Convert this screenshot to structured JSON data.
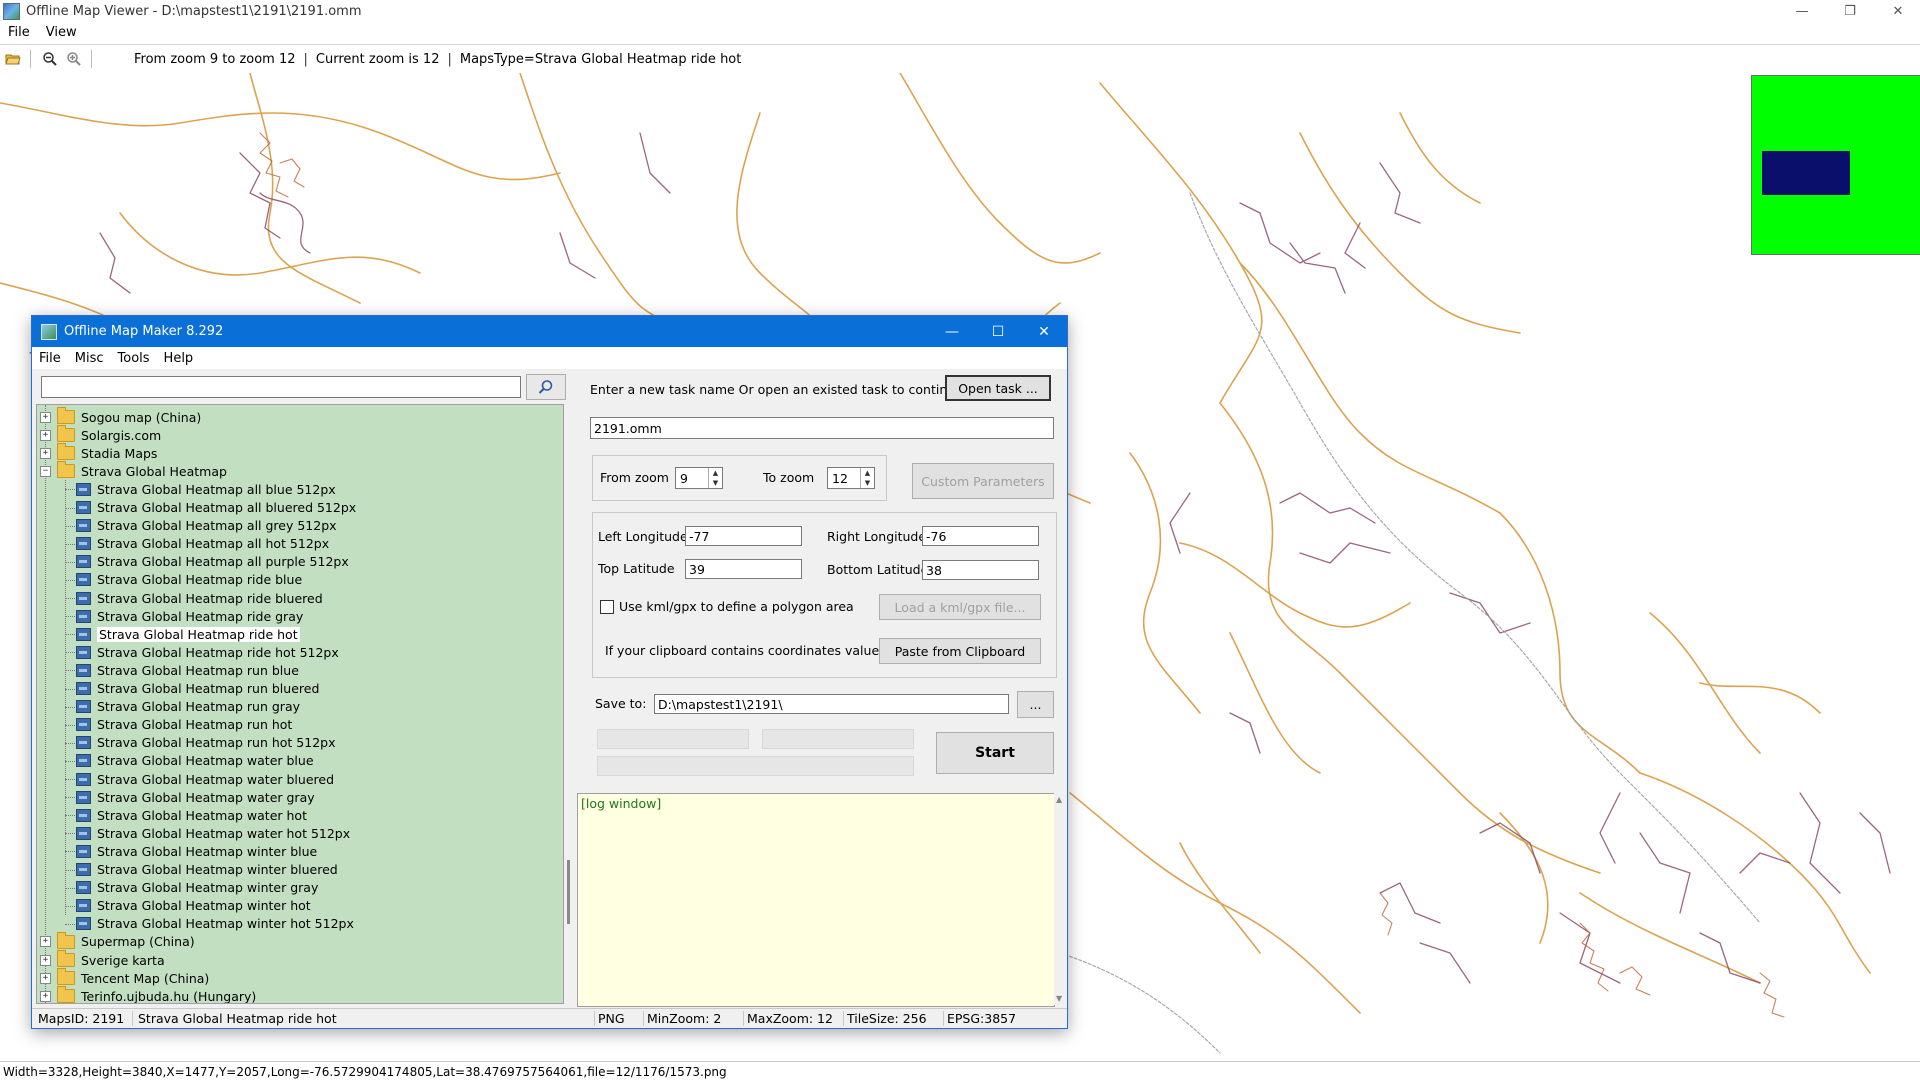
{
  "viewer": {
    "title": "Offline Map Viewer - D:\\mapstest1\\2191\\2191.omm",
    "menu": [
      "File",
      "View"
    ],
    "toolbar": {
      "zoom_range": "From zoom 9 to zoom 12",
      "current_zoom": "Current zoom is 12",
      "maps_type": "MapsType=Strava Global Heatmap ride hot",
      "pipe": "|"
    },
    "status": "Width=3328,Height=3840,X=1477,Y=2057,Long=-76.5729904174805,Lat=38.4769757564061,file=12/1176/1573.png",
    "minimap_color": "#00ff00",
    "minimap_view_color": "#0a0f6b"
  },
  "dialog": {
    "title": "Offline Map Maker 8.292",
    "menu": [
      "File",
      "Misc",
      "Tools",
      "Help"
    ],
    "tree": {
      "items": [
        {
          "label": "Sogou map (China)",
          "type": "folder",
          "expanded": false
        },
        {
          "label": "Solargis.com",
          "type": "folder",
          "expanded": false
        },
        {
          "label": "Stadia Maps",
          "type": "folder",
          "expanded": false
        },
        {
          "label": "Strava Global Heatmap",
          "type": "folder",
          "expanded": true
        },
        {
          "label": "Strava Global Heatmap all blue 512px",
          "type": "map"
        },
        {
          "label": "Strava Global Heatmap all bluered 512px",
          "type": "map"
        },
        {
          "label": "Strava Global Heatmap all grey 512px",
          "type": "map"
        },
        {
          "label": "Strava Global Heatmap all hot 512px",
          "type": "map"
        },
        {
          "label": "Strava Global Heatmap all purple 512px",
          "type": "map"
        },
        {
          "label": "Strava Global Heatmap ride blue",
          "type": "map"
        },
        {
          "label": "Strava Global Heatmap ride bluered",
          "type": "map"
        },
        {
          "label": "Strava Global Heatmap ride gray",
          "type": "map"
        },
        {
          "label": "Strava Global Heatmap ride hot",
          "type": "map",
          "selected": true
        },
        {
          "label": "Strava Global Heatmap ride hot 512px",
          "type": "map"
        },
        {
          "label": "Strava Global Heatmap run blue",
          "type": "map"
        },
        {
          "label": "Strava Global Heatmap run bluered",
          "type": "map"
        },
        {
          "label": "Strava Global Heatmap run gray",
          "type": "map"
        },
        {
          "label": "Strava Global Heatmap run hot",
          "type": "map"
        },
        {
          "label": "Strava Global Heatmap run hot 512px",
          "type": "map"
        },
        {
          "label": "Strava Global Heatmap water blue",
          "type": "map"
        },
        {
          "label": "Strava Global Heatmap water bluered",
          "type": "map"
        },
        {
          "label": "Strava Global Heatmap water gray",
          "type": "map"
        },
        {
          "label": "Strava Global Heatmap water hot",
          "type": "map"
        },
        {
          "label": "Strava Global Heatmap water hot 512px",
          "type": "map"
        },
        {
          "label": "Strava Global Heatmap winter blue",
          "type": "map"
        },
        {
          "label": "Strava Global Heatmap winter bluered",
          "type": "map"
        },
        {
          "label": "Strava Global Heatmap winter gray",
          "type": "map"
        },
        {
          "label": "Strava Global Heatmap winter hot",
          "type": "map"
        },
        {
          "label": "Strava Global Heatmap winter hot 512px",
          "type": "map"
        },
        {
          "label": "Supermap (China)",
          "type": "folder",
          "expanded": false
        },
        {
          "label": "Sverige karta",
          "type": "folder",
          "expanded": false
        },
        {
          "label": "Tencent Map (China)",
          "type": "folder",
          "expanded": false
        },
        {
          "label": "Terinfo.ujbuda.hu (Hungary)",
          "type": "folder",
          "expanded": false
        }
      ]
    },
    "task_prompt": "Enter a new task name Or open an existed task to continue:",
    "open_task_button": "Open task ...",
    "task_name": "2191.omm",
    "from_zoom_label": "From zoom",
    "from_zoom": "9",
    "to_zoom_label": "To zoom",
    "to_zoom": "12",
    "custom_params_button": "Custom Parameters",
    "left_lon_label": "Left Longitude",
    "left_lon": "-77",
    "right_lon_label": "Right Longitude",
    "right_lon": "-76",
    "top_lat_label": "Top Latitude",
    "top_lat": "39",
    "bottom_lat_label": "Bottom Latitude",
    "bottom_lat": "38",
    "kml_checkbox_label": "Use kml/gpx to define a polygon area",
    "load_kml_button": "Load a kml/gpx file...",
    "clipboard_label": "If your clipboard contains coordinates values:",
    "paste_button": "Paste from Clipboard",
    "save_to_label": "Save to:",
    "save_to_path": "D:\\mapstest1\\2191\\",
    "browse_button": "...",
    "start_button": "Start",
    "log_text": "[log window]",
    "status": {
      "maps_id": "MapsID: 2191",
      "maps_name": "Strava Global Heatmap ride hot",
      "format": "PNG",
      "min_zoom": "MinZoom: 2",
      "max_zoom": "MaxZoom: 12",
      "tile_size": "TileSize: 256",
      "epsg": "EPSG:3857"
    }
  }
}
